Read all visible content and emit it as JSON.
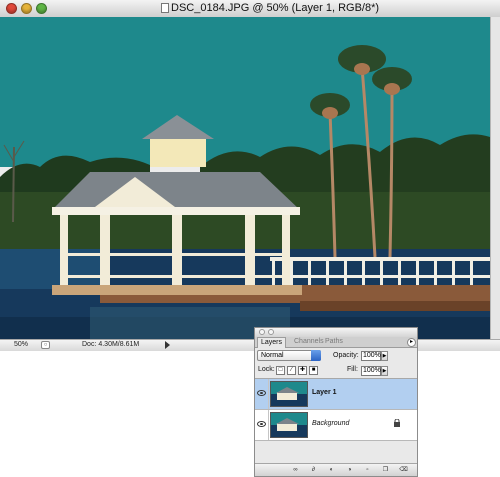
{
  "document": {
    "title": "DSC_0184.JPG @ 50% (Layer 1, RGB/8*)",
    "zoom": "50%",
    "doc_size": "Doc: 4.30M/8.61M"
  },
  "palette": {
    "tabs": [
      "Layers",
      "Channels",
      "Paths"
    ],
    "blend_mode": "Normal",
    "opacity_label": "Opacity:",
    "opacity_value": "100%",
    "lock_label": "Lock:",
    "fill_label": "Fill:",
    "fill_value": "100%",
    "layers": [
      {
        "name": "Layer 1",
        "selected": true,
        "visible": true
      },
      {
        "name": "Background",
        "selected": false,
        "visible": true,
        "locked": true
      }
    ]
  },
  "colors": {
    "sky": "#1f8a8d",
    "water": "#173c5e",
    "selection": "#b2cff0"
  }
}
